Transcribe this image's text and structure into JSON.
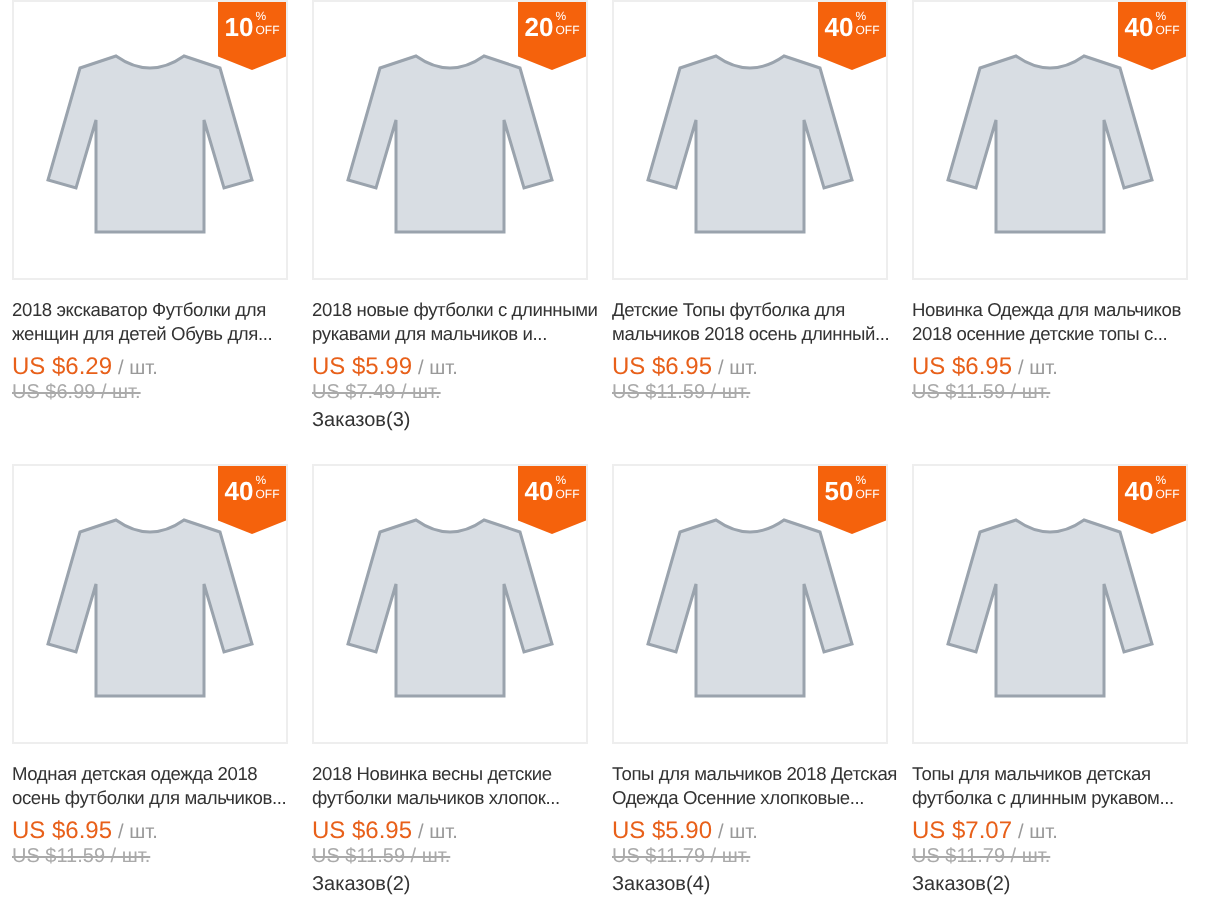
{
  "products": [
    {
      "badge": {
        "value": "10",
        "sign": "%",
        "off": "OFF"
      },
      "title": "2018 экскаватор Футболки для женщин для детей Обувь для...",
      "price": "US $6.29",
      "unit": "/ шт.",
      "old_price": "US $6.99 / шт."
    },
    {
      "badge": {
        "value": "20",
        "sign": "%",
        "off": "OFF"
      },
      "title": "2018 новые футболки с длинными рукавами для мальчиков и...",
      "price": "US $5.99",
      "unit": "/ шт.",
      "old_price": "US $7.49 / шт.",
      "orders": "Заказов(3)"
    },
    {
      "badge": {
        "value": "40",
        "sign": "%",
        "off": "OFF"
      },
      "title": "Детские Топы футболка для мальчиков 2018 осень длинный...",
      "price": "US $6.95",
      "unit": "/ шт.",
      "old_price": "US $11.59 / шт."
    },
    {
      "badge": {
        "value": "40",
        "sign": "%",
        "off": "OFF"
      },
      "title": "Новинка Одежда для мальчиков 2018 осенние детские топы с...",
      "price": "US $6.95",
      "unit": "/ шт.",
      "old_price": "US $11.59 / шт."
    },
    {
      "badge": {
        "value": "40",
        "sign": "%",
        "off": "OFF"
      },
      "title": "Модная детская одежда 2018 осень футболки для мальчиков...",
      "price": "US $6.95",
      "unit": "/ шт.",
      "old_price": "US $11.59 / шт."
    },
    {
      "badge": {
        "value": "40",
        "sign": "%",
        "off": "OFF"
      },
      "title": "2018 Новинка весны детские футболки мальчиков хлопок...",
      "price": "US $6.95",
      "unit": "/ шт.",
      "old_price": "US $11.59 / шт.",
      "orders": "Заказов(2)"
    },
    {
      "badge": {
        "value": "50",
        "sign": "%",
        "off": "OFF"
      },
      "title": "Топы для мальчиков 2018 Детская Одежда Осенние хлопковые...",
      "price": "US $5.90",
      "unit": "/ шт.",
      "old_price": "US $11.79 / шт.",
      "orders": "Заказов(4)"
    },
    {
      "badge": {
        "value": "40",
        "sign": "%",
        "off": "OFF"
      },
      "title": "Топы для мальчиков детская футболка с длинным рукавом...",
      "price": "US $7.07",
      "unit": "/ шт.",
      "old_price": "US $11.79 / шт.",
      "orders": "Заказов(2)"
    }
  ]
}
